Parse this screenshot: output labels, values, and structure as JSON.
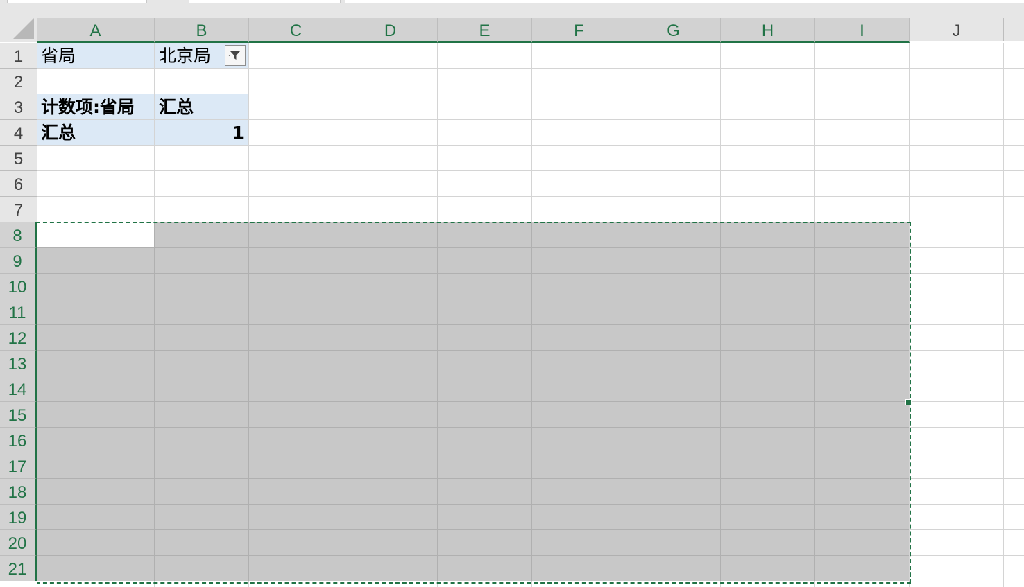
{
  "sheet": {
    "columns": [
      "A",
      "B",
      "C",
      "D",
      "E",
      "F",
      "G",
      "H",
      "I",
      "J"
    ],
    "rows": [
      "1",
      "2",
      "3",
      "4",
      "5",
      "6",
      "7",
      "8",
      "9",
      "10",
      "11",
      "12",
      "13",
      "14",
      "15",
      "16",
      "17",
      "18",
      "19",
      "20",
      "21"
    ]
  },
  "pivot": {
    "filter_label": "省局",
    "filter_value": "北京局",
    "value_header": "计数项:省局",
    "col_header": "汇总",
    "row_label": "汇总",
    "row_value": "1"
  },
  "selection": {
    "range_start": "A8",
    "range_end": "I21",
    "active_cell": "A8"
  },
  "colors": {
    "accent": "#217346",
    "pivot_fill": "#dce9f6",
    "selection_fill": "#c8c8c8"
  }
}
